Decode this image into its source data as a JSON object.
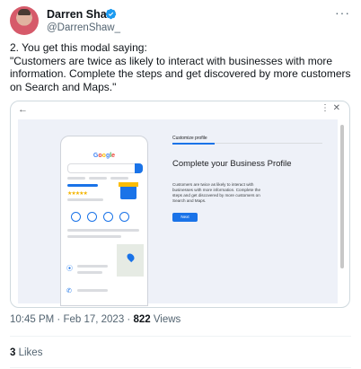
{
  "author": {
    "name": "Darren Shaw",
    "handle": "@DarrenShaw_"
  },
  "tweet": {
    "line1": "2. You get this modal saying:",
    "line2": "\"Customers are twice as likely to interact with businesses with more information. Complete the steps and get discovered by more customers on Search and Maps.\""
  },
  "screenshot": {
    "google_logo": "Google",
    "tab_label": "Customize profile",
    "heading": "Complete your Business Profile",
    "description": "Customers are twice as likely to interact with businesses with more information. Complete the steps and get discovered by more customers on Search and Maps.",
    "next_label": "Next",
    "rating_stars": "★★★★★"
  },
  "meta": {
    "time": "10:45 PM · Feb 17, 2023 · ",
    "views_count": "822",
    "views_label": " Views"
  },
  "likes": {
    "count": "3",
    "label": " Likes"
  },
  "colors": {
    "accent": "#1a73e8",
    "verified": "#1d9bf0"
  }
}
